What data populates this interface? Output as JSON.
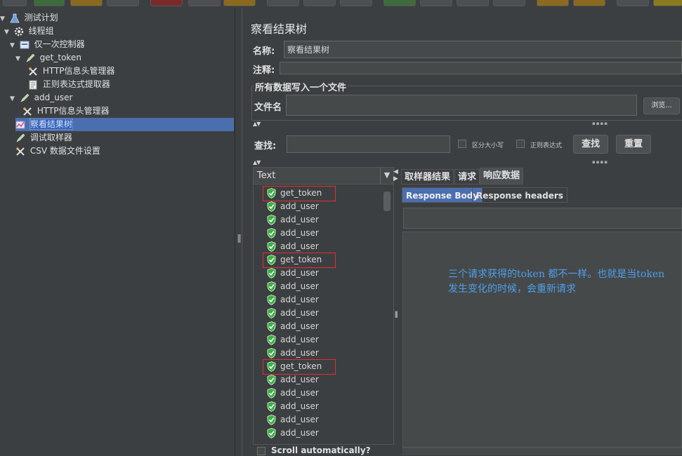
{
  "colors": {
    "selection": "#4b6eaf",
    "highlight_box": "#e03030",
    "note_text": "#4f9fe8",
    "success_green": "#3cb043"
  },
  "tree": {
    "items": [
      {
        "label": "测试计划",
        "icon": "flask-icon",
        "level": 0,
        "expanded": true
      },
      {
        "label": "线程组",
        "icon": "gear-icon",
        "level": 1,
        "expanded": true
      },
      {
        "label": "仅一次控制器",
        "icon": "controller-icon",
        "level": 2,
        "expanded": true
      },
      {
        "label": "get_token",
        "icon": "sampler-pen-icon",
        "level": 3,
        "expanded": true
      },
      {
        "label": "HTTP信息头管理器",
        "icon": "tools-icon",
        "level": 4
      },
      {
        "label": "正则表达式提取器",
        "icon": "document-icon",
        "level": 4
      },
      {
        "label": "add_user",
        "icon": "sampler-pen-icon",
        "level": 2,
        "expanded": true
      },
      {
        "label": "HTTP信息头管理器",
        "icon": "tools-icon",
        "level": 3
      },
      {
        "label": "察看结果树",
        "icon": "listener-chart-icon",
        "level": 2,
        "selected": true
      },
      {
        "label": "调试取样器",
        "icon": "sampler-pen-icon",
        "level": 2
      },
      {
        "label": "CSV 数据文件设置",
        "icon": "tools-icon",
        "level": 2
      }
    ]
  },
  "panel": {
    "title": "察看结果树",
    "name_label": "名称:",
    "name_value": "察看结果树",
    "comment_label": "注释:",
    "comment_value": "",
    "file_group_title": "所有数据写入一个文件",
    "filename_label": "文件名",
    "filename_value": "",
    "browse_button": "浏览...",
    "search_label": "查找:",
    "search_value": "",
    "case_sensitive_label": "区分大小写",
    "regex_label": "正则表达式",
    "find_button": "查找",
    "reset_button": "重置"
  },
  "results": {
    "renderer": "Text",
    "items": [
      "get_token",
      "add_user",
      "add_user",
      "add_user",
      "add_user",
      "get_token",
      "add_user",
      "add_user",
      "add_user",
      "add_user",
      "add_user",
      "add_user",
      "add_user",
      "get_token",
      "add_user",
      "add_user",
      "add_user",
      "add_user",
      "add_user"
    ],
    "scroll_auto_label": "Scroll automatically?"
  },
  "tabs": {
    "main": [
      "取样器结果",
      "请求",
      "响应数据"
    ],
    "active_main": "响应数据",
    "sub": [
      "Response Body",
      "Response headers"
    ],
    "active_sub": "Response Body"
  },
  "note": {
    "text": "三个请求获得的token 都不一样。也就是当token发生变化的时候，会重新请求"
  }
}
